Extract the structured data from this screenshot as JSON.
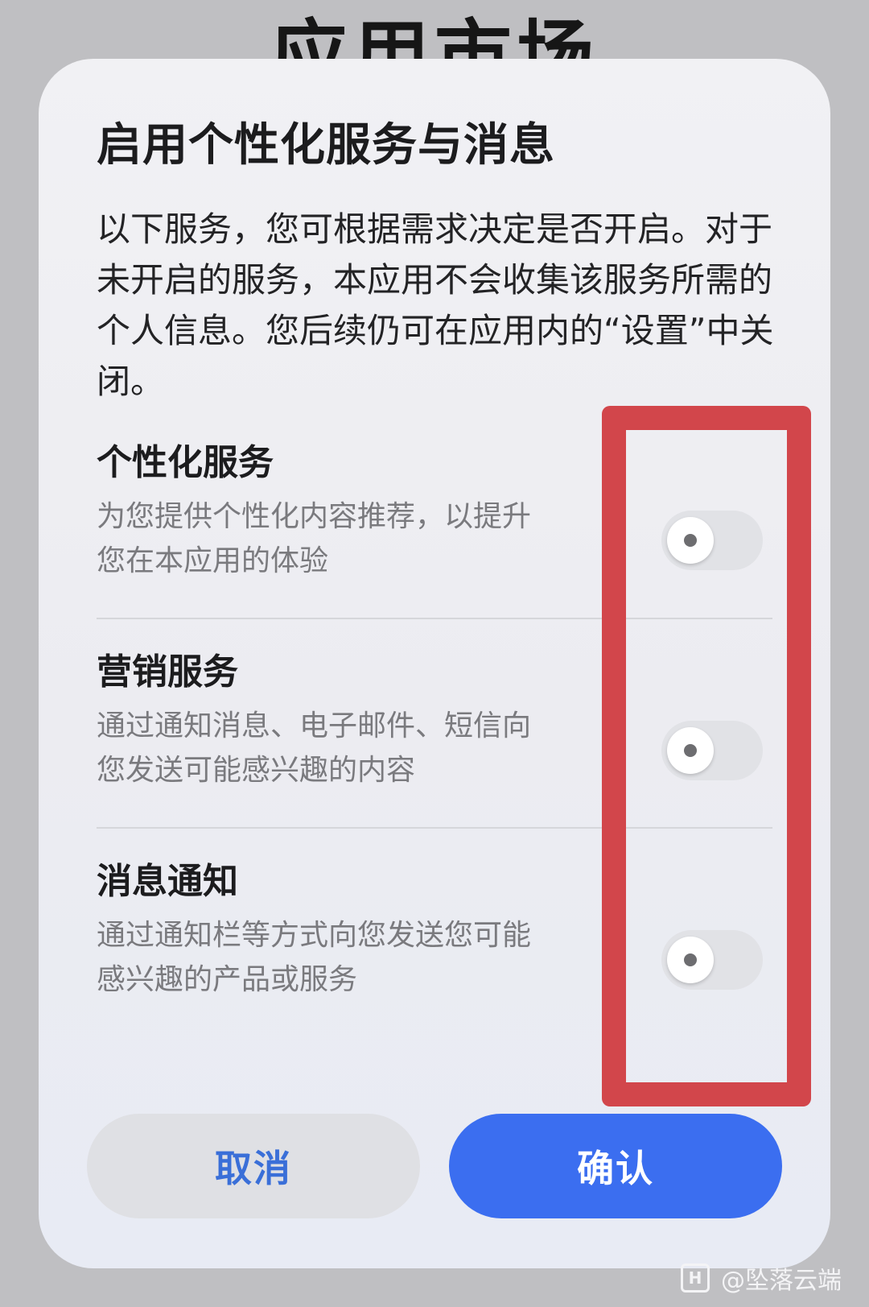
{
  "background": {
    "app_title": "应用市场"
  },
  "dialog": {
    "title": "启用个性化服务与消息",
    "description": "以下服务，您可根据需求决定是否开启。对于未开启的服务，本应用不会收集该服务所需的个人信息。您后续仍可在应用内的“设置”中关闭。",
    "items": [
      {
        "title": "个性化服务",
        "description": "为您提供个性化内容推荐，以提升\n您在本应用的体验",
        "enabled": false
      },
      {
        "title": "营销服务",
        "description": "通过通知消息、电子邮件、短信向\n您发送可能感兴趣的内容",
        "enabled": false
      },
      {
        "title": "消息通知",
        "description": "通过通知栏等方式向您发送您可能\n感兴趣的产品或服务",
        "enabled": false
      }
    ],
    "cancel_label": "取消",
    "confirm_label": "确认"
  },
  "watermark": {
    "logo": "H",
    "text": "@坠落云端"
  },
  "colors": {
    "accent": "#3b6ef0",
    "highlight": "#d2464b",
    "toggle_off": "#e1e2e6"
  },
  "icons": {
    "toggle": "toggle-switch-off",
    "watermark": "platform-logo-icon"
  }
}
